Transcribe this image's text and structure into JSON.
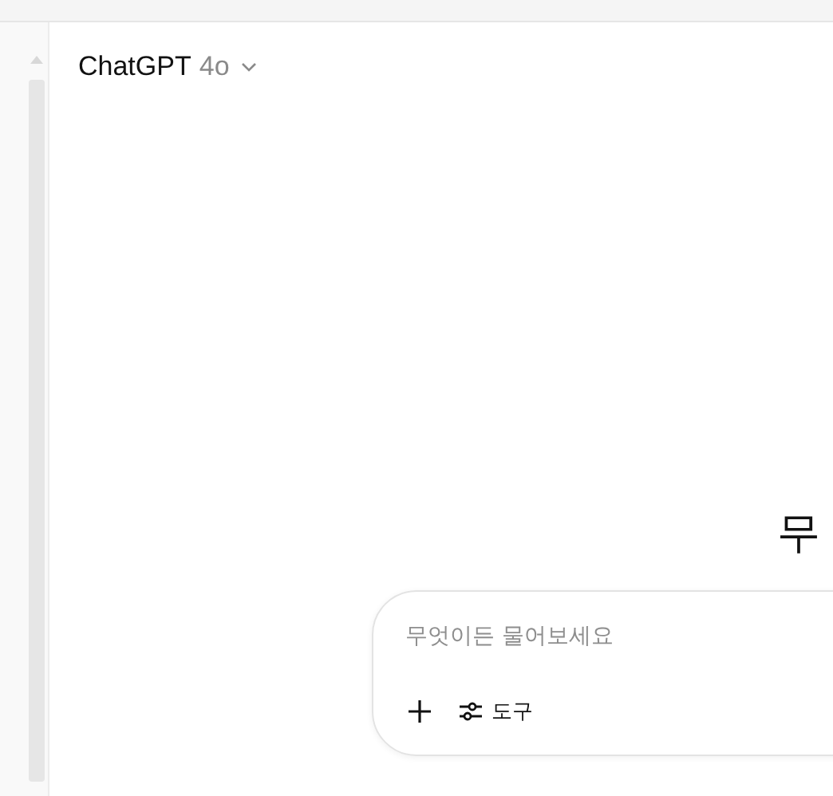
{
  "header": {
    "title": "ChatGPT",
    "model": "4o"
  },
  "headline": "무",
  "composer": {
    "placeholder": "무엇이든 물어보세요",
    "tools_label": "도구"
  }
}
